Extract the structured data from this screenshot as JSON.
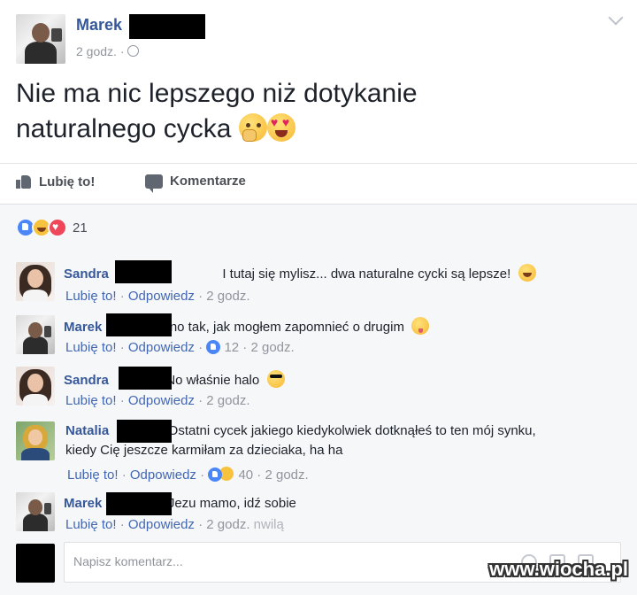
{
  "post": {
    "author": "Marek",
    "time": "2 godz.",
    "privacy_icon": "globe-icon",
    "text": "Nie ma nic lepszego niż dotykanie naturalnego cycka",
    "emojis": [
      "thinking-hand-emoji",
      "heart-eyes-emoji"
    ]
  },
  "actions": {
    "like": "Lubię to!",
    "comment": "Komentarze"
  },
  "reactions": {
    "types": [
      "like",
      "haha",
      "love"
    ],
    "count": "21"
  },
  "comments": [
    {
      "author": "Sandra",
      "text": "I tutaj się mylisz... dwa naturalne cycki są lepsze!",
      "like": "Lubię to!",
      "reply": "Odpowiedz",
      "time": "2 godz.",
      "emoji": "laughing-emoji"
    },
    {
      "author": "Marek",
      "text": "no tak, jak mogłem zapomnieć o drugim",
      "like": "Lubię to!",
      "reply": "Odpowiedz",
      "reaction_count": "12",
      "time": "2 godz.",
      "emoji": "tongue-out-emoji"
    },
    {
      "author": "Sandra",
      "text": "No właśnie halo",
      "like": "Lubię to!",
      "reply": "Odpowiedz",
      "time": "2 godz.",
      "emoji": "sunglasses-emoji"
    },
    {
      "author": "Natalia",
      "text_line1": "Ostatni cycek jakiego kiedykolwiek dotknąłeś to ten mój synku,",
      "text_line2": "kiedy Cię jeszcze karmiłam za dzieciaka, ha ha",
      "like": "Lubię to!",
      "reply": "Odpowiedz",
      "reaction_count": "40",
      "time": "2 godz."
    },
    {
      "author": "Marek",
      "text": "Jezu mamo, idź sobie",
      "like": "Lubię to!",
      "reply": "Odpowiedz",
      "time": "2 godz.",
      "extra": "nwilą"
    }
  ],
  "composer": {
    "placeholder": "Napisz komentarz..."
  },
  "watermark": "www.wiocha.pl"
}
